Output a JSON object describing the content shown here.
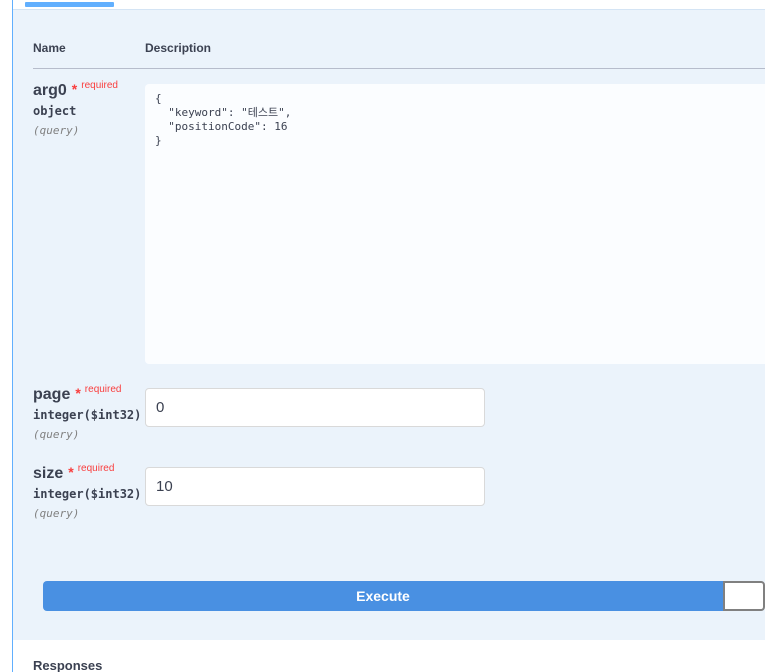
{
  "table": {
    "name_header": "Name",
    "description_header": "Description"
  },
  "params": [
    {
      "name": "arg0",
      "required_mark": "*",
      "required_label": "required",
      "type": "object",
      "location": "(query)",
      "value": "{\n  \"keyword\": \"테스트\",\n  \"positionCode\": 16\n}"
    },
    {
      "name": "page",
      "required_mark": "*",
      "required_label": "required",
      "type": "integer($int32)",
      "location": "(query)",
      "value": "0"
    },
    {
      "name": "size",
      "required_mark": "*",
      "required_label": "required",
      "type": "integer($int32)",
      "location": "(query)",
      "value": "10"
    }
  ],
  "actions": {
    "execute_label": "Execute",
    "clear_label": ""
  },
  "responses": {
    "title": "Responses"
  },
  "colors": {
    "accent": "#61affe",
    "execute": "#4990e2",
    "required": "#f93e3e",
    "panel_bg": "#ebf3fb"
  }
}
